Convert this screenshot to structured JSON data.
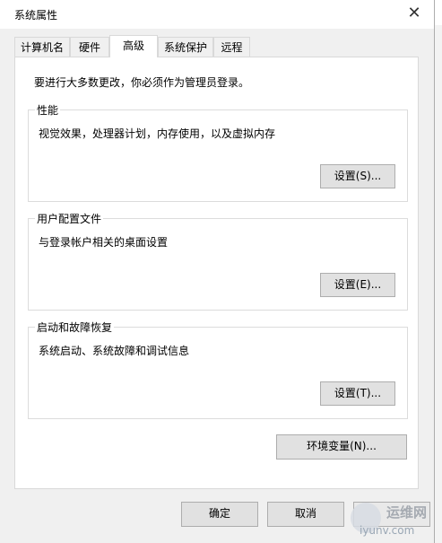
{
  "window": {
    "title": "系统属性",
    "close_glyph": "✕"
  },
  "tabs": [
    {
      "label": "计算机名",
      "active": false
    },
    {
      "label": "硬件",
      "active": false
    },
    {
      "label": "高级",
      "active": true
    },
    {
      "label": "系统保护",
      "active": false
    },
    {
      "label": "远程",
      "active": false
    }
  ],
  "intro": "要进行大多数更改，你必须作为管理员登录。",
  "groups": {
    "performance": {
      "label": "性能",
      "desc": "视觉效果，处理器计划，内存使用，以及虚拟内存",
      "button": "设置(S)..."
    },
    "profiles": {
      "label": "用户配置文件",
      "desc": "与登录帐户相关的桌面设置",
      "button": "设置(E)..."
    },
    "startup": {
      "label": "启动和故障恢复",
      "desc": "系统启动、系统故障和调试信息",
      "button": "设置(T)..."
    }
  },
  "env_button": "环境变量(N)...",
  "footer": {
    "ok": "确定",
    "cancel": "取消"
  },
  "watermark": {
    "cn": "运维网",
    "en": "iyunv.com"
  },
  "colors": {
    "dialog_bg": "#f0f0f0",
    "panel_bg": "#ffffff",
    "button_bg": "#e1e1e1",
    "button_border": "#adadad"
  }
}
